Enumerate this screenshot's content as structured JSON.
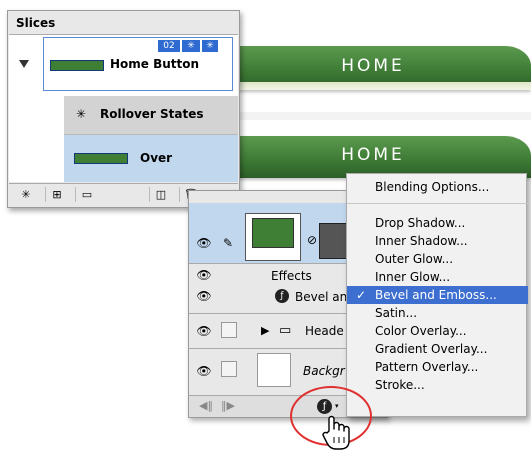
{
  "buttons": {
    "home_text": "HOME"
  },
  "slices": {
    "title": "Slices",
    "badge_number": "02",
    "home_row_label": "Home Button",
    "rollover_label": "Rollover States",
    "over_label": "Over"
  },
  "layers": {
    "effects_label": "Effects",
    "bevel_label": "Bevel an",
    "header_label": "Heade",
    "background_label": "Backgr"
  },
  "menu": {
    "items": [
      {
        "label": "Blending Options..."
      },
      {
        "label": "Drop Shadow..."
      },
      {
        "label": "Inner Shadow..."
      },
      {
        "label": "Outer Glow..."
      },
      {
        "label": "Inner Glow..."
      },
      {
        "label": "Bevel and Emboss...",
        "checked": "✓"
      },
      {
        "label": "Satin..."
      },
      {
        "label": "Color Overlay..."
      },
      {
        "label": "Gradient Overlay..."
      },
      {
        "label": "Pattern Overlay..."
      },
      {
        "label": "Stroke..."
      }
    ],
    "selected_index": 5
  },
  "colors": {
    "accent": "#3d6fd1",
    "button_green": "#3f7c36",
    "highlight_circle": "#e03030"
  },
  "icons": [
    "eye-icon",
    "brush-icon",
    "chain-link-icon",
    "folder-icon",
    "effects-icon",
    "trash-icon",
    "hand-cursor-icon"
  ]
}
